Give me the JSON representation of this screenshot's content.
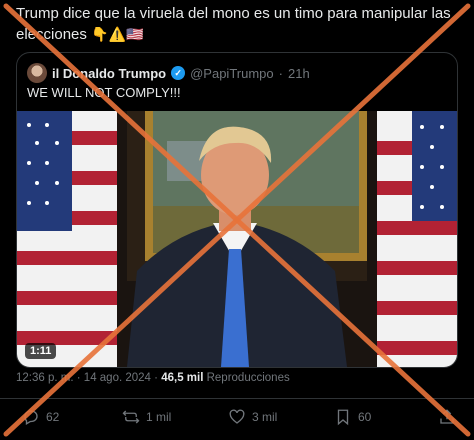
{
  "post": {
    "text": "Trump dice que la viruela del mono es un timo para manipular las elecciones",
    "emojis": [
      "👇",
      "⚠️",
      "🇺🇸"
    ]
  },
  "quote": {
    "name": "il Donaldo Trumpo",
    "handle": "@PapiTrumpo",
    "separator": "·",
    "time": "21h",
    "text": "WE WILL NOT COMPLY!!!",
    "video_duration": "1:11"
  },
  "meta": {
    "time": "12:36 p. m.",
    "separator": "·",
    "date": "14 ago. 2024",
    "views_count": "46,5 mil",
    "views_label": "Reproducciones"
  },
  "actions": {
    "replies": "62",
    "reposts": "1 mil",
    "likes": "3 mil",
    "bookmarks": "60"
  },
  "colors": {
    "background": "#000000",
    "muted": "#71767b",
    "verified": "#1d9bf0",
    "overlay_x": "#e8733a"
  }
}
